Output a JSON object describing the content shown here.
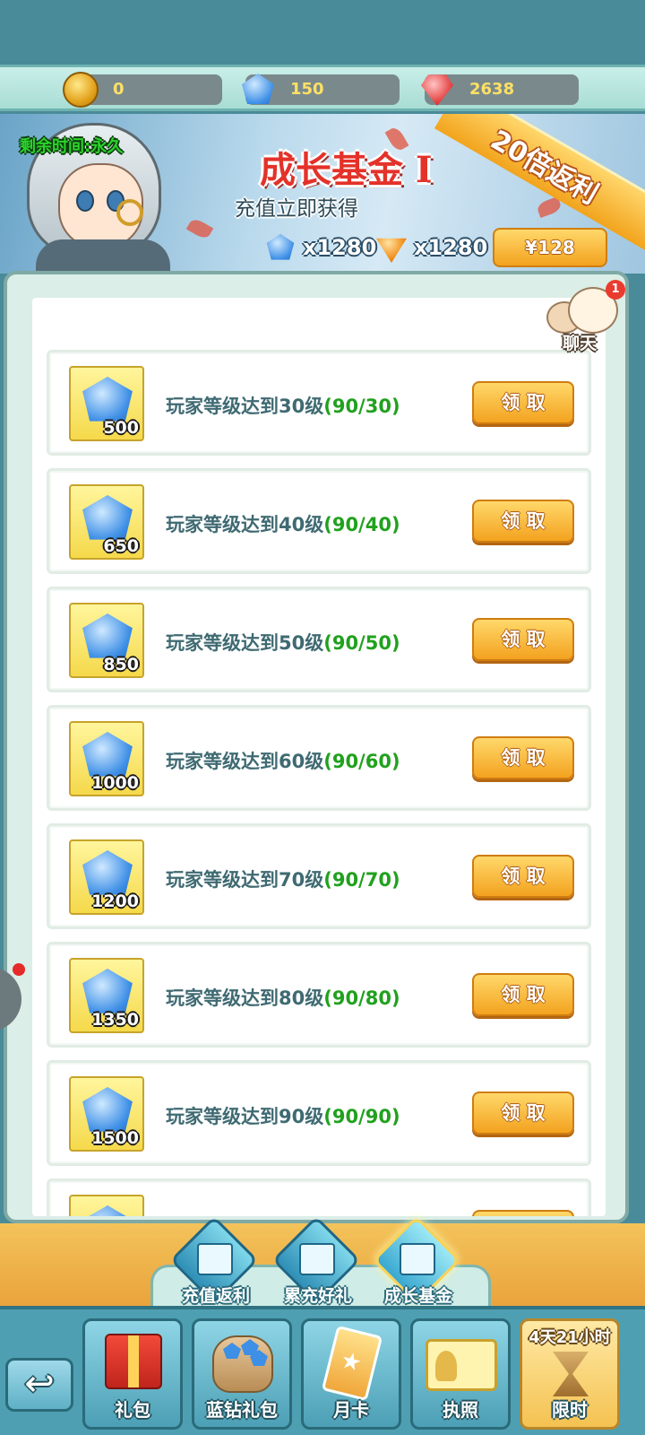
{
  "currency": {
    "coins": "0",
    "blue_diamonds": "150",
    "red_gems": "2638"
  },
  "banner": {
    "remaining_time": "剩余时间:永久",
    "title": "成长基金 I",
    "ribbon": "20倍返利",
    "subtitle": "充值立即获得",
    "reward_diamonds": "x1280",
    "reward_orange": "x1280",
    "price": "¥128"
  },
  "chat": {
    "label": "聊天",
    "badge": "1"
  },
  "rewards": [
    {
      "qty": "500",
      "desc": "玩家等级达到30级",
      "progress": "(90/30)",
      "button": "领 取"
    },
    {
      "qty": "650",
      "desc": "玩家等级达到40级",
      "progress": "(90/40)",
      "button": "领 取"
    },
    {
      "qty": "850",
      "desc": "玩家等级达到50级",
      "progress": "(90/50)",
      "button": "领 取"
    },
    {
      "qty": "1000",
      "desc": "玩家等级达到60级",
      "progress": "(90/60)",
      "button": "领 取"
    },
    {
      "qty": "1200",
      "desc": "玩家等级达到70级",
      "progress": "(90/70)",
      "button": "领 取"
    },
    {
      "qty": "1350",
      "desc": "玩家等级达到80级",
      "progress": "(90/80)",
      "button": "领 取"
    },
    {
      "qty": "1500",
      "desc": "玩家等级达到90级",
      "progress": "(90/90)",
      "button": "领 取"
    }
  ],
  "sub_tabs": [
    {
      "label": "充值返利"
    },
    {
      "label": "累充好礼"
    },
    {
      "label": "成长基金",
      "active": true
    }
  ],
  "bottom_nav": {
    "back": "↩",
    "gift_pack": "礼包",
    "blue_gift_pack": "蓝钻礼包",
    "monthly_card": "月卡",
    "license": "执照",
    "limited_timer": "4天21小时",
    "limited": "限时"
  }
}
